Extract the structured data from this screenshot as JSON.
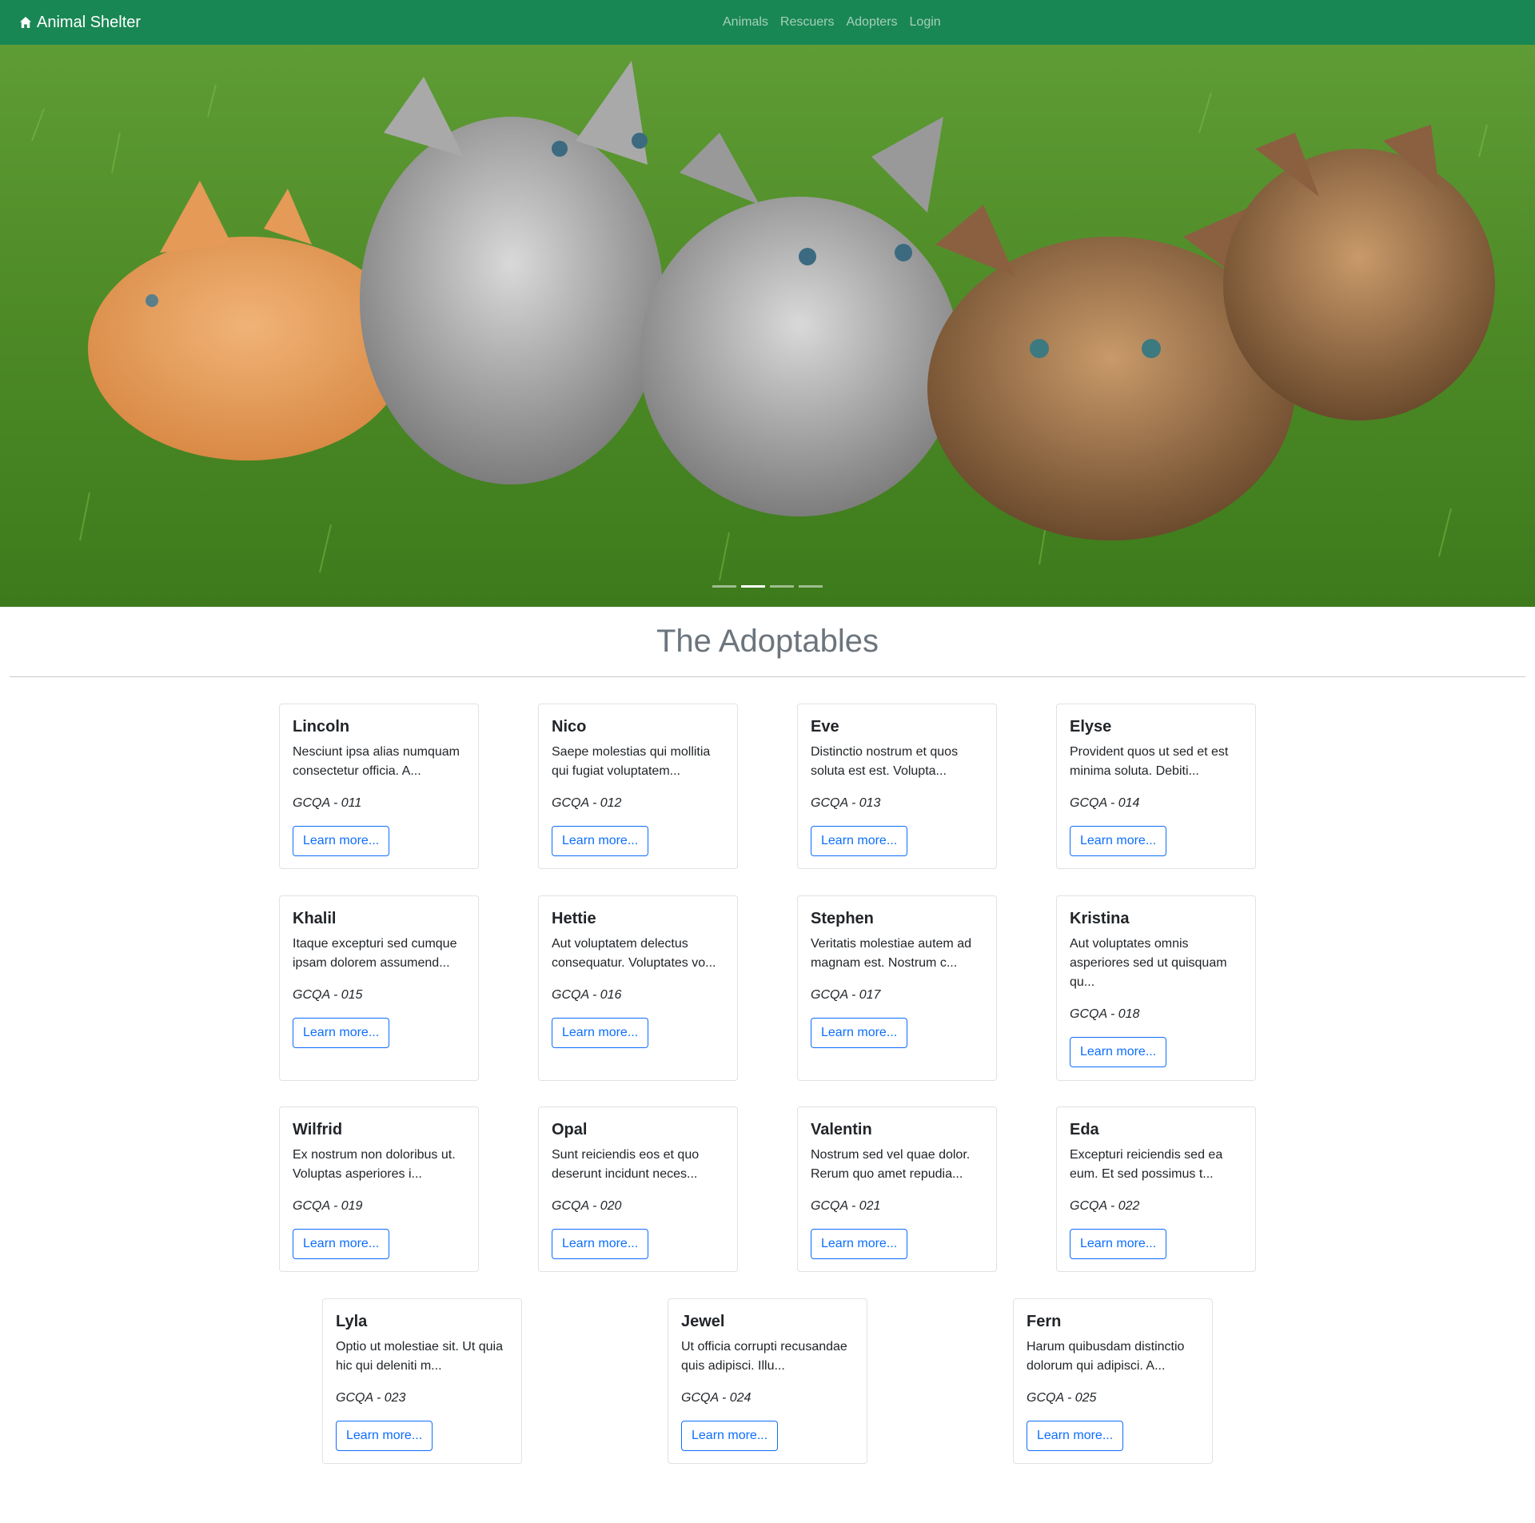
{
  "navbar": {
    "brand": "Animal Shelter",
    "brand_icon": "home-icon",
    "links": [
      "Animals",
      "Rescuers",
      "Adopters",
      "Login"
    ],
    "color": "#198754"
  },
  "hero": {
    "slides_count": 4,
    "active_slide": 2
  },
  "section": {
    "title": "The Adoptables"
  },
  "cards": [
    {
      "name": "Lincoln",
      "description": "Nesciunt ipsa alias numquam consectetur officia. A...",
      "code": "GCQA - 011",
      "button": "Learn more..."
    },
    {
      "name": "Nico",
      "description": "Saepe molestias qui mollitia qui fugiat voluptatem...",
      "code": "GCQA - 012",
      "button": "Learn more..."
    },
    {
      "name": "Eve",
      "description": "Distinctio nostrum et quos soluta est est. Volupta...",
      "code": "GCQA - 013",
      "button": "Learn more..."
    },
    {
      "name": "Elyse",
      "description": "Provident quos ut sed et est minima soluta. Debiti...",
      "code": "GCQA - 014",
      "button": "Learn more..."
    },
    {
      "name": "Khalil",
      "description": "Itaque excepturi sed cumque ipsam dolorem assumend...",
      "code": "GCQA - 015",
      "button": "Learn more..."
    },
    {
      "name": "Hettie",
      "description": "Aut voluptatem delectus consequatur. Voluptates vo...",
      "code": "GCQA - 016",
      "button": "Learn more..."
    },
    {
      "name": "Stephen",
      "description": "Veritatis molestiae autem ad magnam est. Nostrum c...",
      "code": "GCQA - 017",
      "button": "Learn more..."
    },
    {
      "name": "Kristina",
      "description": "Aut voluptates omnis asperiores sed ut quisquam qu...",
      "code": "GCQA - 018",
      "button": "Learn more..."
    },
    {
      "name": "Wilfrid",
      "description": "Ex nostrum non doloribus ut. Voluptas asperiores i...",
      "code": "GCQA - 019",
      "button": "Learn more..."
    },
    {
      "name": "Opal",
      "description": "Sunt reiciendis eos et quo deserunt incidunt neces...",
      "code": "GCQA - 020",
      "button": "Learn more..."
    },
    {
      "name": "Valentin",
      "description": "Nostrum sed vel quae dolor. Rerum quo amet repudia...",
      "code": "GCQA - 021",
      "button": "Learn more..."
    },
    {
      "name": "Eda",
      "description": "Excepturi reiciendis sed ea eum. Et sed possimus t...",
      "code": "GCQA - 022",
      "button": "Learn more..."
    },
    {
      "name": "Lyla",
      "description": "Optio ut molestiae sit. Ut quia hic qui deleniti m...",
      "code": "GCQA - 023",
      "button": "Learn more..."
    },
    {
      "name": "Jewel",
      "description": "Ut officia corrupti recusandae quis adipisci. Illu...",
      "code": "GCQA - 024",
      "button": "Learn more..."
    },
    {
      "name": "Fern",
      "description": "Harum quibusdam distinctio dolorum qui adipisci. A...",
      "code": "GCQA - 025",
      "button": "Learn more..."
    }
  ]
}
